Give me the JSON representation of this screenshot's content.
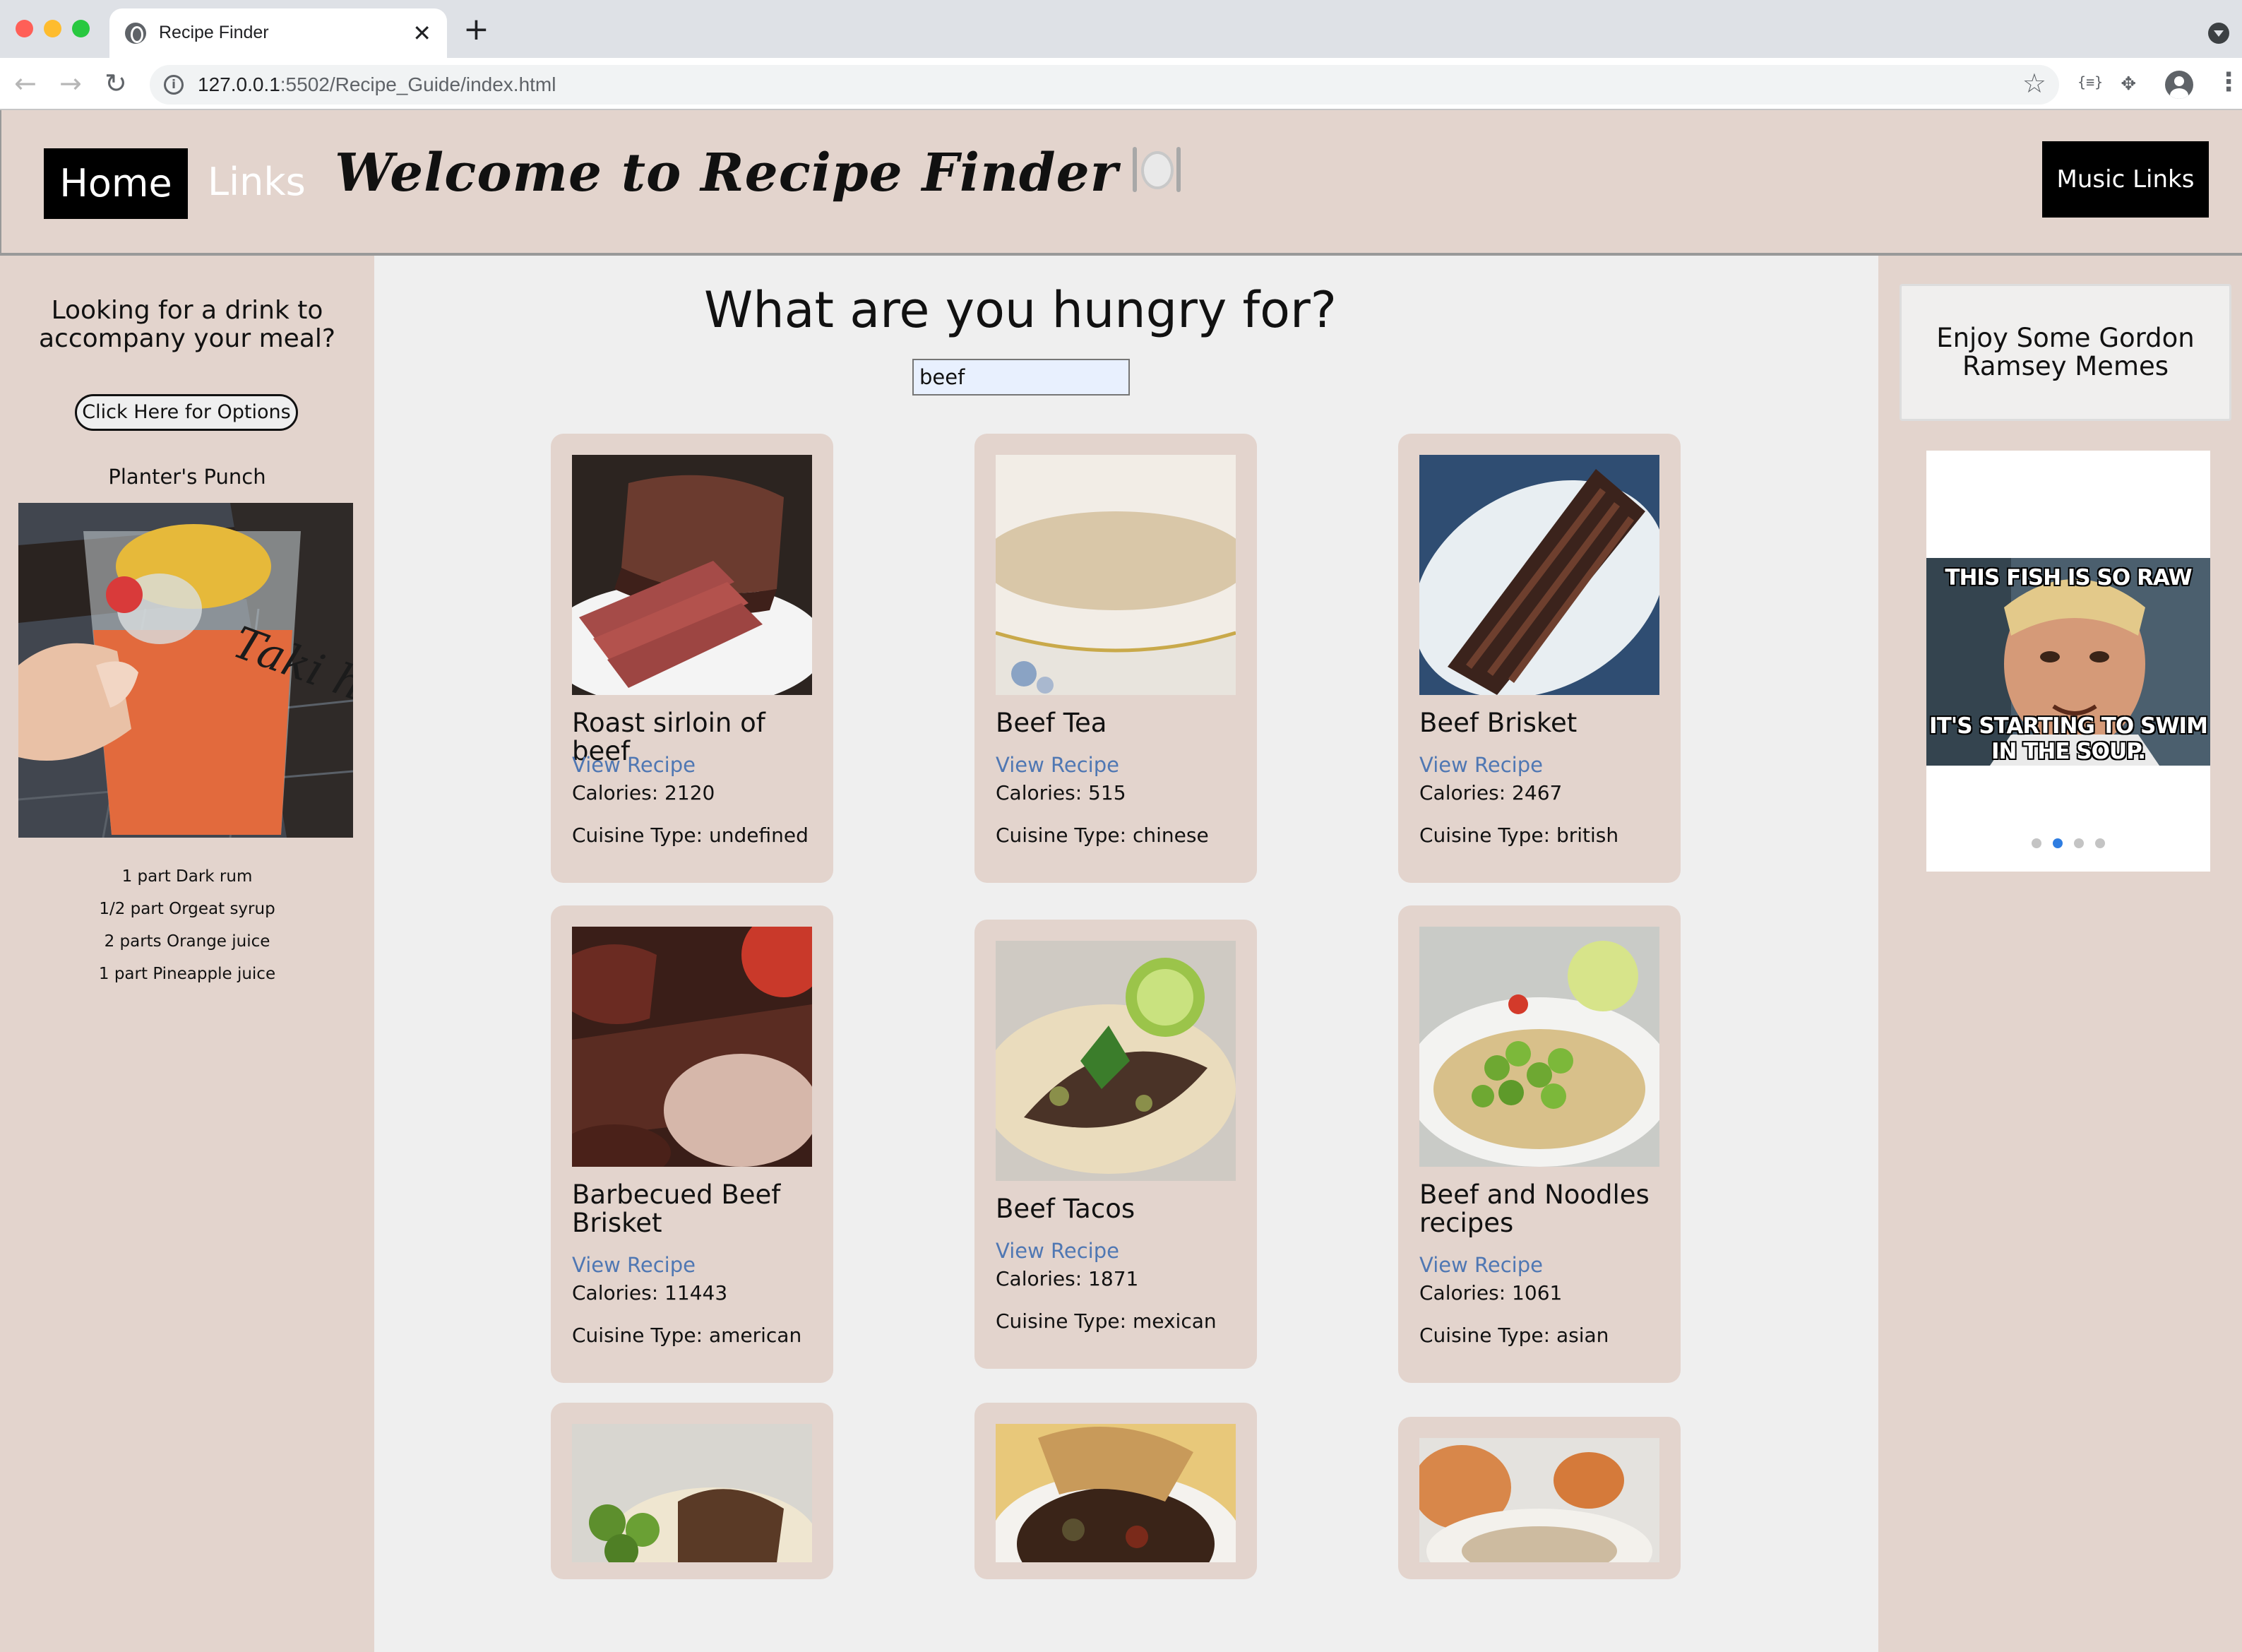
{
  "browser": {
    "tab_title": "Recipe Finder",
    "tab_close": "✕",
    "new_tab": "+",
    "url_host": "127.0.0.1",
    "url_rest": ":5502/Recipe_Guide/index.html",
    "ext_label": "{≡}"
  },
  "header": {
    "home_label": "Home",
    "links_label": "Links",
    "title": "Welcome to Recipe Finder",
    "music_label": "Music Links"
  },
  "left": {
    "question": "Looking for a drink to accompany your meal?",
    "options_label": "Click Here for Options",
    "drink_name": "Planter's Punch",
    "glass_text": "Taki hik",
    "ingredients": [
      "1 part Dark rum",
      "1/2 part Orgeat syrup",
      "2 parts Orange juice",
      "1 part Pineapple juice"
    ]
  },
  "main": {
    "heading": "What are you hungry for?",
    "search_value": "beef",
    "view_label": "View Recipe",
    "cards": [
      {
        "title": "Roast sirloin of beef",
        "calories": "Calories: 2120",
        "cuisine": "Cuisine Type: undefined"
      },
      {
        "title": "Beef Tea",
        "calories": "Calories: 515",
        "cuisine": "Cuisine Type: chinese"
      },
      {
        "title": "Beef Brisket",
        "calories": "Calories: 2467",
        "cuisine": "Cuisine Type: british"
      },
      {
        "title": "Barbecued Beef Brisket",
        "calories": "Calories: 11443",
        "cuisine": "Cuisine Type: american"
      },
      {
        "title": "Beef Tacos",
        "calories": "Calories: 1871",
        "cuisine": "Cuisine Type: mexican"
      },
      {
        "title": "Beef and Noodles recipes",
        "calories": "Calories: 1061",
        "cuisine": "Cuisine Type: asian"
      }
    ]
  },
  "right": {
    "memes_title": "Enjoy Some Gordon Ramsey Memes",
    "meme_top": "THIS FISH IS SO RAW",
    "meme_bottom": "IT'S STARTING TO SWIM IN THE SOUP.",
    "active_slide": 2,
    "slide_count": 4
  },
  "icons": {
    "site_icon": "globe-icon",
    "back": "back-arrow-icon",
    "forward": "forward-arrow-icon",
    "reload": "reload-icon",
    "bookmark": "star-icon",
    "extensions": "puzzle-icon",
    "profile": "avatar-icon",
    "title_decoration": "plate-cutlery-icon"
  },
  "colors": {
    "panel_bg": "#e3d4cd",
    "page_bg": "#efefef",
    "link": "#4f77b3",
    "button_bg": "#000000"
  }
}
